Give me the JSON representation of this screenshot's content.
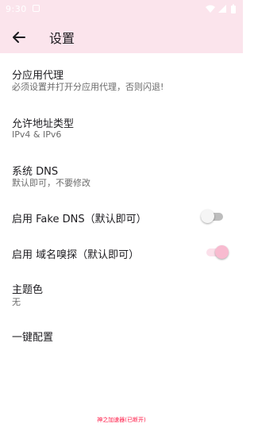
{
  "status_bar": {
    "time": "9:30"
  },
  "app_bar": {
    "title": "设置"
  },
  "settings": [
    {
      "title": "分应用代理",
      "subtitle": "必须设置并打开分应用代理，否则闪退!"
    },
    {
      "title": "允许地址类型",
      "subtitle": "IPv4 & IPv6"
    },
    {
      "title": "系统 DNS",
      "subtitle": "默认即可，不要修改"
    },
    {
      "title": "启用 Fake DNS（默认即可）",
      "enabled": false
    },
    {
      "title": "启用 域名嗅探（默认即可）",
      "enabled": true
    },
    {
      "title": "主题色",
      "subtitle": "无"
    },
    {
      "title": "一键配置"
    }
  ],
  "footer": {
    "text": "神之加速器(已断开)"
  },
  "colors": {
    "appbar": "#fbe4ec",
    "switch_on_thumb": "#f8bbd0",
    "switch_on_track": "#fbe0ea",
    "footer": "#ff1744"
  }
}
